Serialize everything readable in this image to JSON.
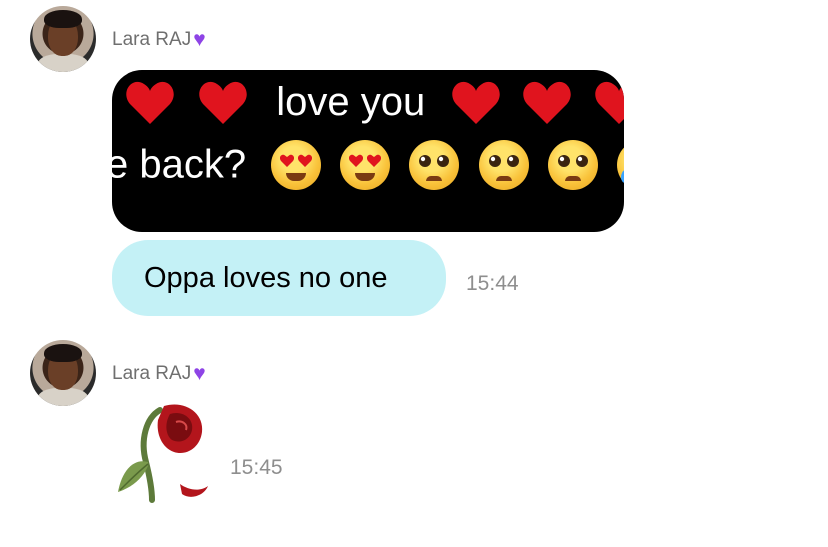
{
  "messages": [
    {
      "sender": "Lara RAJ",
      "sender_badge_icon": "purple-heart-icon",
      "image": {
        "line1_text": "love you",
        "line2_text": "e back?",
        "line1_icons": [
          "red-heart-icon",
          "red-heart-icon",
          "red-heart-icon",
          "red-heart-icon",
          "red-heart-icon"
        ],
        "line2_icons": [
          "heart-eyes-emoji",
          "heart-eyes-emoji",
          "pleading-face-emoji",
          "pleading-face-emoji",
          "pleading-face-emoji",
          "crying-face-emoji"
        ]
      }
    },
    {
      "text": "Oppa loves no one",
      "time": "15:44",
      "bubble_color": "#c4f1f6"
    },
    {
      "sender": "Lara RAJ",
      "sender_badge_icon": "purple-heart-icon",
      "sticker": "wilted-rose-emoji",
      "time": "15:45"
    }
  ],
  "colors": {
    "sender_text": "#6f6f6f",
    "time_text": "#8e8e8e",
    "purple_heart": "#8e44e6"
  }
}
